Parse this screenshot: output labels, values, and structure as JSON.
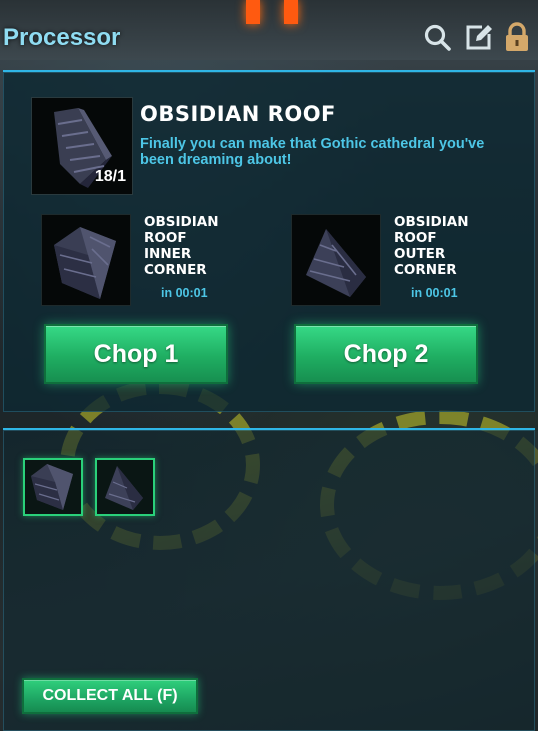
{
  "header": {
    "title": "Processor",
    "icons": [
      "search-icon",
      "edit-icon",
      "lock-icon"
    ]
  },
  "item": {
    "name": "OBSIDIAN ROOF",
    "count": "18/1",
    "description": "Finally you can make that Gothic cathedral you've been dreaming about!"
  },
  "recipes": [
    {
      "name": "OBSIDIAN\nROOF\nINNER\nCORNER",
      "time": "in 00:01",
      "button": "Chop 1"
    },
    {
      "name": "OBSIDIAN\nROOF\nOUTER\nCORNER",
      "time": "in 00:01",
      "button": "Chop 2"
    }
  ],
  "output": {
    "slots": [
      "obsidian-roof-inner-corner",
      "obsidian-roof-outer-corner"
    ],
    "collect_label": "COLLECT ALL (F)"
  },
  "colors": {
    "accent": "#2fb6e6",
    "title": "#8fdcf2",
    "description": "#4dc6e6",
    "button": "#1fae62"
  }
}
